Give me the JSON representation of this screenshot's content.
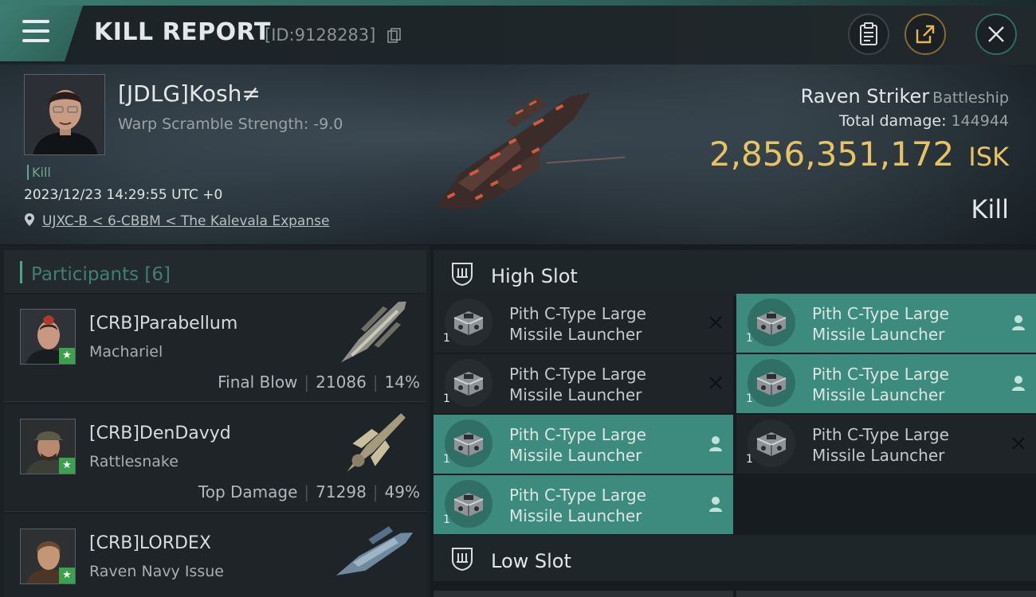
{
  "header": {
    "title": "KILL REPORT",
    "id_text": "[ID:9128283]"
  },
  "victim": {
    "name": "[JDLG]Kosh≠",
    "warp_scramble": "Warp Scramble Strength: -9.0",
    "tag": "Kill",
    "datetime": "2023/12/23 14:29:55 UTC +0",
    "location": "UJXC-B < 6-CBBM < The Kalevala Expanse",
    "ship": "Raven Striker",
    "ship_class": "Battleship",
    "total_damage_label": "Total damage:",
    "total_damage": "144944",
    "isk_value": "2,856,351,172",
    "isk_unit": "ISK",
    "result": "Kill"
  },
  "participants": {
    "label": "Participants",
    "count": "[6]",
    "items": [
      {
        "name": "[CRB]Parabellum",
        "ship": "Machariel",
        "role": "Final Blow",
        "damage": "21086",
        "percent": "14%"
      },
      {
        "name": "[CRB]DenDavyd",
        "ship": "Rattlesnake",
        "role": "Top Damage",
        "damage": "71298",
        "percent": "49%"
      },
      {
        "name": "[CRB]LORDEX",
        "ship": "Raven Navy Issue",
        "role": "",
        "damage": "",
        "percent": ""
      }
    ]
  },
  "fitting": {
    "high_slot_label": "High Slot",
    "low_slot_label": "Low Slot",
    "high_slots": [
      {
        "name": "Pith C-Type Large Missile Launcher",
        "qty": "1",
        "status": "destroyed"
      },
      {
        "name": "Pith C-Type Large Missile Launcher",
        "qty": "1",
        "status": "dropped"
      },
      {
        "name": "Pith C-Type Large Missile Launcher",
        "qty": "1",
        "status": "destroyed"
      },
      {
        "name": "Pith C-Type Large Missile Launcher",
        "qty": "1",
        "status": "dropped"
      },
      {
        "name": "Pith C-Type Large Missile Launcher",
        "qty": "1",
        "status": "dropped"
      },
      {
        "name": "Pith C-Type Large Missile Launcher",
        "qty": "1",
        "status": "destroyed"
      },
      {
        "name": "Pith C-Type Large Missile Launcher",
        "qty": "1",
        "status": "dropped"
      }
    ]
  },
  "colors": {
    "accent_teal": "#3d8b7f",
    "isk_gold": "#e7c362",
    "final_blow_star": "#3aa24c"
  },
  "icons": [
    "menu-icon",
    "copy-icon",
    "clipboard-icon",
    "share-icon",
    "close-icon",
    "location-pin-icon",
    "slot-icon",
    "destroyed-x-icon",
    "dropped-person-icon",
    "missile-launcher-icon",
    "star-icon"
  ]
}
